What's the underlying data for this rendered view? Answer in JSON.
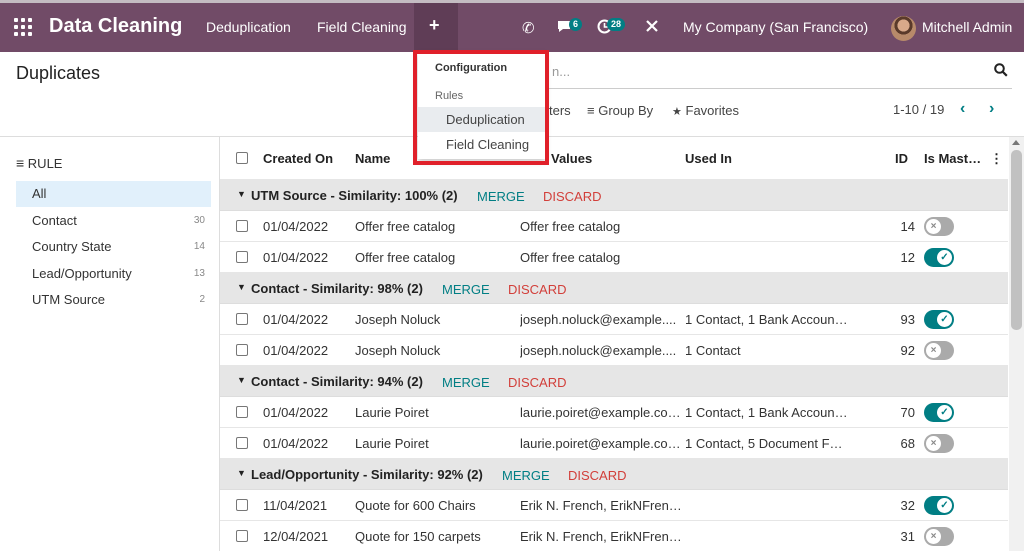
{
  "navbar": {
    "app_name": "Data Cleaning",
    "menus": [
      "Deduplication",
      "Field Cleaning"
    ],
    "plus_icon": "+",
    "phone_icon": "✆",
    "chat_badge": "6",
    "activity_badge": "28",
    "tools_icon": "✗",
    "company": "My Company (San Francisco)",
    "user": "Mitchell Admin"
  },
  "page": {
    "title": "Duplicates",
    "search_placeholder": "Search...",
    "search_visible_tail": "n...",
    "filters_tail": "ters",
    "group_by": "Group By",
    "favorites": "Favorites",
    "pager": "1-10 / 19"
  },
  "dropdown": {
    "header": "Configuration",
    "section": "Rules",
    "items": [
      "Deduplication",
      "Field Cleaning"
    ]
  },
  "side": {
    "heading": "RULE",
    "items": [
      {
        "label": "All",
        "count": ""
      },
      {
        "label": "Contact",
        "count": "30"
      },
      {
        "label": "Country State",
        "count": "14"
      },
      {
        "label": "Lead/Opportunity",
        "count": "13"
      },
      {
        "label": "UTM Source",
        "count": "2"
      }
    ]
  },
  "list": {
    "columns": [
      "Created On",
      "Name",
      "Values",
      "Used In",
      "ID",
      "Is Mast…"
    ],
    "merge_label": "MERGE",
    "discard_label": "DISCARD",
    "groups": [
      {
        "title": "UTM Source - Similarity: 100% (2)",
        "rows": [
          {
            "created": "01/04/2022",
            "name": "Offer free catalog",
            "values": "Offer free catalog",
            "used_in": "",
            "id": "14",
            "master": false
          },
          {
            "created": "01/04/2022",
            "name": "Offer free catalog",
            "values": "Offer free catalog",
            "used_in": "",
            "id": "12",
            "master": true
          }
        ]
      },
      {
        "title": "Contact - Similarity: 98% (2)",
        "rows": [
          {
            "created": "01/04/2022",
            "name": "Joseph Noluck",
            "values": "joseph.noluck@example....",
            "used_in": "1 Contact, 1 Bank Accoun…",
            "id": "93",
            "master": true
          },
          {
            "created": "01/04/2022",
            "name": "Joseph Noluck",
            "values": "joseph.noluck@example....",
            "used_in": "1 Contact",
            "id": "92",
            "master": false
          }
        ]
      },
      {
        "title": "Contact - Similarity: 94% (2)",
        "rows": [
          {
            "created": "01/04/2022",
            "name": "Laurie Poiret",
            "values": "laurie.poiret@example.co…",
            "used_in": "1 Contact, 1 Bank Accoun…",
            "id": "70",
            "master": true
          },
          {
            "created": "01/04/2022",
            "name": "Laurie Poiret",
            "values": "laurie.poiret@example.co…",
            "used_in": "1 Contact, 5 Document F…",
            "id": "68",
            "master": false
          }
        ]
      },
      {
        "title": "Lead/Opportunity - Similarity: 92% (2)",
        "rows": [
          {
            "created": "11/04/2021",
            "name": "Quote for 600 Chairs",
            "values": "Erik N. French, ErikNFren…",
            "used_in": "",
            "id": "32",
            "master": true
          },
          {
            "created": "12/04/2021",
            "name": "Quote for 150 carpets",
            "values": "Erik N. French, ErikNFren…",
            "used_in": "",
            "id": "31",
            "master": false
          }
        ]
      }
    ]
  },
  "colors": {
    "navbar": "#714b67",
    "accent": "#017e84",
    "discard": "#d23f3a",
    "highlight_outline": "#e0202a"
  }
}
